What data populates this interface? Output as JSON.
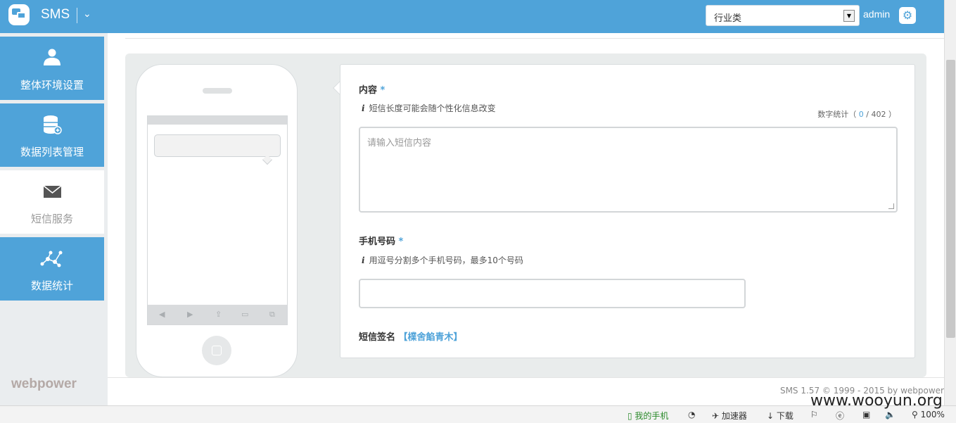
{
  "header": {
    "brand": "SMS",
    "caret": "⌄",
    "category_select": {
      "value": "行业类"
    },
    "user": "admin"
  },
  "sidebar": {
    "items": [
      {
        "label": "整体环境设置",
        "icon": "user-icon"
      },
      {
        "label": "数据列表管理",
        "icon": "database-icon"
      },
      {
        "label": "短信服务",
        "icon": "envelope-icon",
        "active": true
      },
      {
        "label": "数据统计",
        "icon": "network-icon"
      }
    ],
    "logo_text": "webpower"
  },
  "form": {
    "content_label": "内容",
    "required_mark": "*",
    "content_hint": "短信长度可能会随个性化信息改变",
    "counter_prefix": "数字统计",
    "counter_value": "0",
    "counter_max": "402",
    "content_placeholder": "请输入短信内容",
    "phone_label": "手机号码",
    "phone_hint": "用逗号分割多个手机号码，最多10个号码",
    "signature_label": "短信签名",
    "signature_value": "【檏舍餡青木】"
  },
  "footer": {
    "copyright": "SMS 1.57 © 1999 - 2015 by webpower"
  },
  "browser_status": {
    "my_phone": "我的手机",
    "accelerator": "加速器",
    "download": "下载",
    "zoom": "100%"
  },
  "watermark": "www.wooyun.org",
  "colors": {
    "accent": "#4fa3d9"
  }
}
